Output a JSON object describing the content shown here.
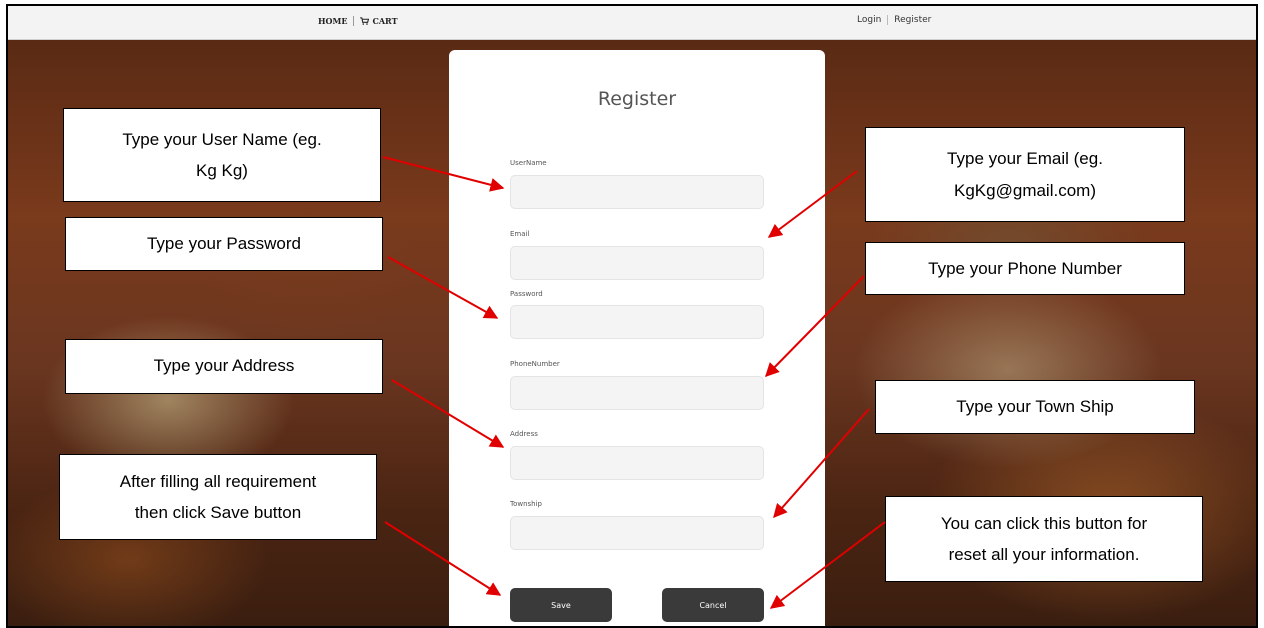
{
  "nav": {
    "home": "HOME",
    "cart": "CART",
    "login": "Login",
    "register": "Register"
  },
  "form": {
    "title": "Register",
    "fields": [
      {
        "label": "UserName",
        "value": ""
      },
      {
        "label": "Email",
        "value": ""
      },
      {
        "label": "Password",
        "value": ""
      },
      {
        "label": "PhoneNumber",
        "value": ""
      },
      {
        "label": "Address",
        "value": ""
      },
      {
        "label": "Township",
        "value": ""
      }
    ],
    "save_label": "Save",
    "cancel_label": "Cancel"
  },
  "callouts": {
    "username_line1": "Type your User Name (eg.",
    "username_line2": "Kg Kg)",
    "password": "Type your Password",
    "address": "Type your Address",
    "save_line1": "After filling all requirement",
    "save_line2": "then click Save button",
    "email_line1": "Type your Email (eg.",
    "email_line2": "KgKg@gmail.com)",
    "phone": "Type your Phone Number",
    "township": "Type your Town Ship",
    "cancel_line1": "You can click this button for",
    "cancel_line2": "reset all your information."
  },
  "colors": {
    "arrow": "#e10000",
    "button": "#3a3a3a",
    "input_bg": "#f4f4f4"
  },
  "icons": {
    "cart": "shopping-cart-icon"
  }
}
